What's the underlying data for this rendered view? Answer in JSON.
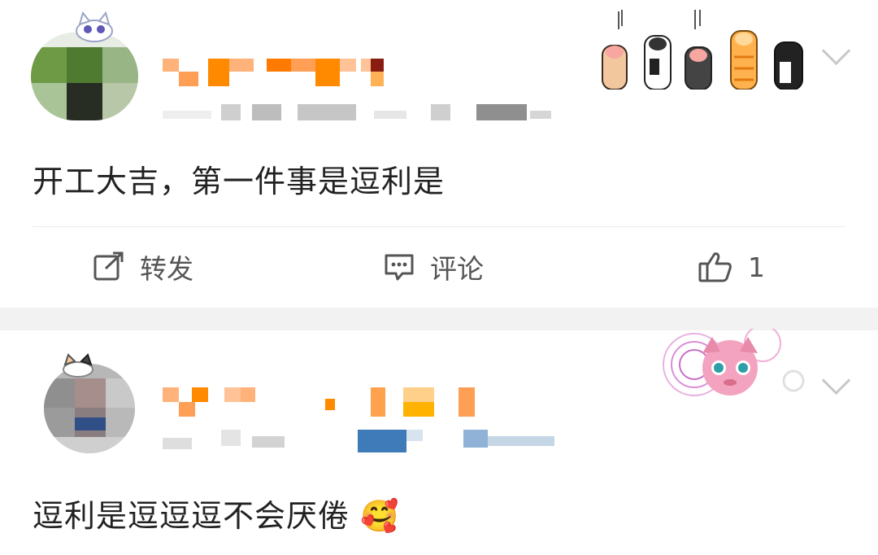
{
  "post1": {
    "content": "开工大吉，第一件事是逗利是",
    "actions": {
      "repost_label": "转发",
      "comment_label": "评论",
      "like_count": "1"
    },
    "icons": [
      "repost-icon",
      "comment-icon",
      "like-icon",
      "chevron-down-icon"
    ]
  },
  "post2": {
    "content": "逗利是逗逗逗不会厌倦",
    "emoji": "🥰"
  },
  "colors": {
    "text": "#222222",
    "action_text": "#555555",
    "divider": "#ececec",
    "separator_bg": "#f2f2f2",
    "name_mosaic": "#ff8a00",
    "chevron": "#c8c8c8"
  }
}
